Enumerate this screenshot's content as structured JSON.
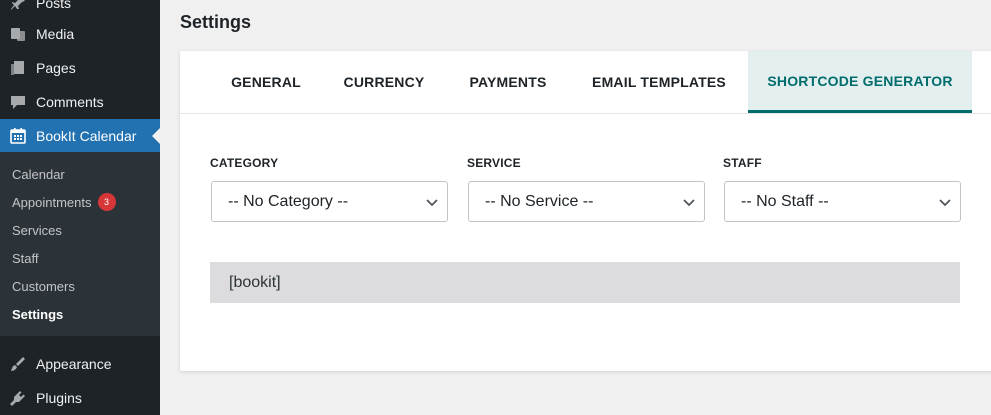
{
  "sidebar": {
    "items": [
      {
        "label": "Posts",
        "icon": "pin-icon"
      },
      {
        "label": "Media",
        "icon": "media-icon"
      },
      {
        "label": "Pages",
        "icon": "pages-icon"
      },
      {
        "label": "Comments",
        "icon": "comments-icon"
      },
      {
        "label": "BookIt Calendar",
        "icon": "calendar-icon"
      },
      {
        "label": "Appearance",
        "icon": "appearance-icon"
      },
      {
        "label": "Plugins",
        "icon": "plugins-icon"
      }
    ],
    "submenu": [
      {
        "label": "Calendar"
      },
      {
        "label": "Appointments",
        "badge": "3"
      },
      {
        "label": "Services"
      },
      {
        "label": "Staff"
      },
      {
        "label": "Customers"
      },
      {
        "label": "Settings"
      }
    ]
  },
  "page": {
    "title": "Settings"
  },
  "tabs": [
    {
      "label": "GENERAL"
    },
    {
      "label": "CURRENCY"
    },
    {
      "label": "PAYMENTS"
    },
    {
      "label": "EMAIL TEMPLATES"
    },
    {
      "label": "SHORTCODE GENERATOR"
    }
  ],
  "fields": {
    "category": {
      "label": "CATEGORY",
      "value": "-- No Category --"
    },
    "service": {
      "label": "SERVICE",
      "value": "-- No Service --"
    },
    "staff": {
      "label": "STAFF",
      "value": "-- No Staff --"
    }
  },
  "shortcode": "[bookit]",
  "colors": {
    "accent": "#2271b1",
    "tab_active": "#006c6c",
    "badge": "#d63638"
  }
}
